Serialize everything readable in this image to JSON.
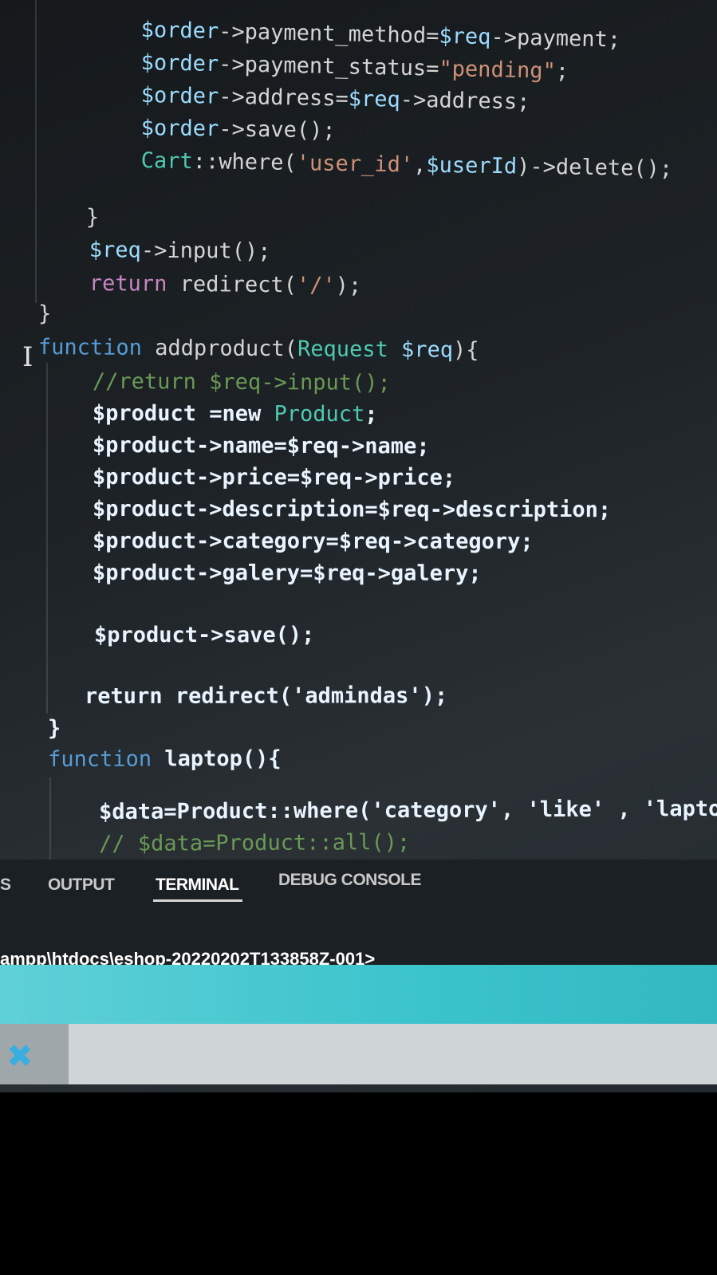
{
  "code": {
    "lines": [
      {
        "id": "l1",
        "segments": [
          {
            "t": "$order",
            "c": "var"
          },
          {
            "t": "->payment_method=",
            "c": "txt"
          },
          {
            "t": "$req",
            "c": "var"
          },
          {
            "t": "->payment;",
            "c": "txt"
          }
        ]
      },
      {
        "id": "l2",
        "segments": [
          {
            "t": "$order",
            "c": "var"
          },
          {
            "t": "->payment_status=",
            "c": "txt"
          },
          {
            "t": "\"pending\"",
            "c": "str"
          },
          {
            "t": ";",
            "c": "txt"
          }
        ]
      },
      {
        "id": "l3",
        "segments": [
          {
            "t": "$order",
            "c": "var"
          },
          {
            "t": "->address=",
            "c": "txt"
          },
          {
            "t": "$req",
            "c": "var"
          },
          {
            "t": "->address;",
            "c": "txt"
          }
        ]
      },
      {
        "id": "l4",
        "segments": [
          {
            "t": "$order",
            "c": "var"
          },
          {
            "t": "->save();",
            "c": "txt"
          }
        ]
      },
      {
        "id": "l5",
        "segments": [
          {
            "t": "Cart",
            "c": "cls"
          },
          {
            "t": "::where(",
            "c": "txt"
          },
          {
            "t": "'user_id'",
            "c": "str"
          },
          {
            "t": ",",
            "c": "txt"
          },
          {
            "t": "$userId",
            "c": "var"
          },
          {
            "t": ")->delete();",
            "c": "txt"
          }
        ]
      },
      {
        "id": "l6",
        "segments": [
          {
            "t": "}",
            "c": "txt"
          }
        ]
      },
      {
        "id": "l7",
        "segments": [
          {
            "t": "$req",
            "c": "var"
          },
          {
            "t": "->input();",
            "c": "txt"
          }
        ]
      },
      {
        "id": "l8",
        "segments": [
          {
            "t": "return",
            "c": "kw"
          },
          {
            "t": " redirect(",
            "c": "txt"
          },
          {
            "t": "'/'",
            "c": "str"
          },
          {
            "t": ");",
            "c": "txt"
          }
        ]
      },
      {
        "id": "l9",
        "segments": [
          {
            "t": "}",
            "c": "txt"
          }
        ]
      },
      {
        "id": "l10",
        "segments": [
          {
            "t": "function",
            "c": "kwb"
          },
          {
            "t": " addproduct(",
            "c": "txt"
          },
          {
            "t": "Request",
            "c": "cls"
          },
          {
            "t": " $req",
            "c": "var"
          },
          {
            "t": "){",
            "c": "txt"
          }
        ]
      },
      {
        "id": "l11",
        "segments": [
          {
            "t": "//return $req->input();",
            "c": "cmt"
          }
        ]
      },
      {
        "id": "l12",
        "segments": [
          {
            "t": "$product",
            "c": "var"
          },
          {
            "t": " =new ",
            "c": "txt"
          },
          {
            "t": "Product",
            "c": "cls"
          },
          {
            "t": ";",
            "c": "txt"
          }
        ]
      },
      {
        "id": "l13",
        "segments": [
          {
            "t": "$product",
            "c": "var"
          },
          {
            "t": "->name=",
            "c": "txt"
          },
          {
            "t": "$req",
            "c": "var"
          },
          {
            "t": "->name;",
            "c": "txt"
          }
        ]
      },
      {
        "id": "l14",
        "segments": [
          {
            "t": "$product",
            "c": "var"
          },
          {
            "t": "->price=",
            "c": "txt"
          },
          {
            "t": "$req",
            "c": "var"
          },
          {
            "t": "->price;",
            "c": "txt"
          }
        ]
      },
      {
        "id": "l15",
        "segments": [
          {
            "t": "$product",
            "c": "var"
          },
          {
            "t": "->description=",
            "c": "txt"
          },
          {
            "t": "$req",
            "c": "var"
          },
          {
            "t": "->description;",
            "c": "txt"
          }
        ]
      },
      {
        "id": "l16",
        "segments": [
          {
            "t": "$product",
            "c": "var"
          },
          {
            "t": "->category=",
            "c": "txt"
          },
          {
            "t": "$req",
            "c": "var"
          },
          {
            "t": "->category;",
            "c": "txt"
          }
        ]
      },
      {
        "id": "l17",
        "segments": [
          {
            "t": "$product",
            "c": "var"
          },
          {
            "t": "->galery=",
            "c": "txt"
          },
          {
            "t": "$req",
            "c": "var"
          },
          {
            "t": "->galery;",
            "c": "txt"
          }
        ]
      },
      {
        "id": "l18",
        "segments": [
          {
            "t": "$product",
            "c": "var"
          },
          {
            "t": "->save();",
            "c": "txt"
          }
        ]
      },
      {
        "id": "l19",
        "segments": [
          {
            "t": "return redirect(",
            "c": "txt"
          },
          {
            "t": "'admindas'",
            "c": "txt"
          },
          {
            "t": ");",
            "c": "txt"
          }
        ]
      },
      {
        "id": "l20",
        "segments": [
          {
            "t": "}",
            "c": "txt"
          }
        ]
      },
      {
        "id": "l21",
        "segments": [
          {
            "t": "function",
            "c": "kwb"
          },
          {
            "t": " laptop(){",
            "c": "txt"
          }
        ]
      },
      {
        "id": "l22",
        "segments": [
          {
            "t": "$data",
            "c": "var"
          },
          {
            "t": "=Product::where(",
            "c": "txt"
          },
          {
            "t": "'category'",
            "c": "txt"
          },
          {
            "t": ", ",
            "c": "txt"
          },
          {
            "t": "'like'",
            "c": "txt"
          },
          {
            "t": " , ",
            "c": "txt"
          },
          {
            "t": "'laptop'",
            "c": "txt"
          }
        ]
      },
      {
        "id": "l23",
        "segments": [
          {
            "t": "// $data=Product::all();",
            "c": "cmt"
          }
        ]
      }
    ]
  },
  "panel": {
    "tab_prev": "S",
    "tab_output": "OUTPUT",
    "tab_terminal": "TERMINAL",
    "tab_debug": "DEBUG CONSOLE",
    "terminal_prompt": "ampp\\htdocs\\eshop-20220202T133858Z-001>"
  },
  "colors": {
    "status_bar": "#3bc3cc",
    "background": "#1d2226"
  },
  "icons": {
    "text_cursor": "text-cursor-icon",
    "vscode": "vscode-icon"
  }
}
